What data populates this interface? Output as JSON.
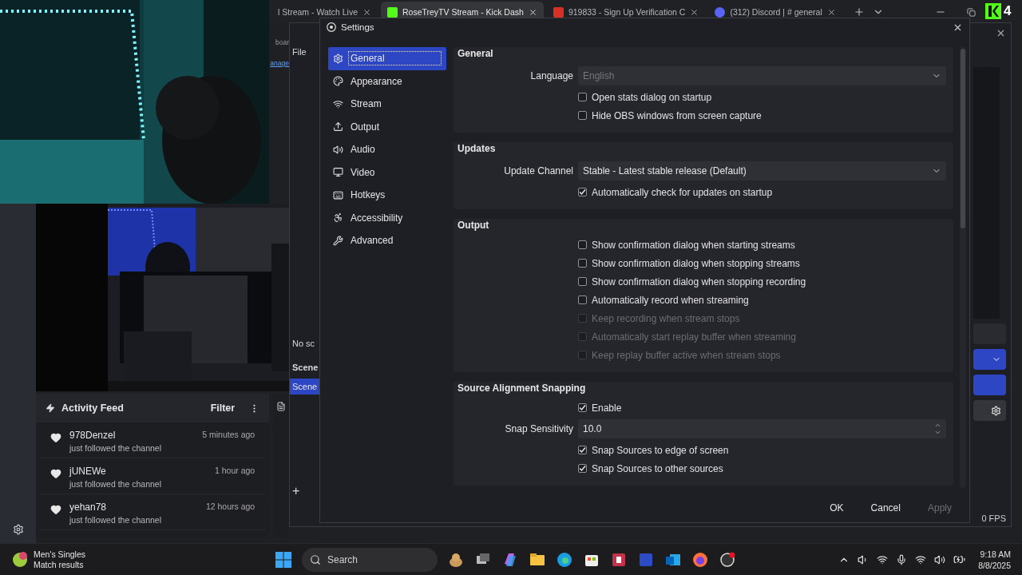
{
  "browser": {
    "tabs": [
      {
        "title": "l Stream - Watch Live",
        "selected": false
      },
      {
        "title": "RoseTreyTV Stream - Kick Dash",
        "selected": true
      },
      {
        "title": "919833 - Sign Up Verification C",
        "selected": false
      },
      {
        "title": "(312) Discord | # general",
        "selected": false
      }
    ],
    "page_fragments": [
      "boar",
      "anage"
    ]
  },
  "stream_overlay": {
    "follower_count": "4"
  },
  "activity_feed": {
    "title": "Activity Feed",
    "filter": "Filter",
    "items": [
      {
        "name": "978Denzel",
        "time": "5 minutes ago",
        "action": "just followed the channel"
      },
      {
        "name": "jUNEWe",
        "time": "1 hour ago",
        "action": "just followed the channel"
      },
      {
        "name": "yehan78",
        "time": "12 hours ago",
        "action": "just followed the channel"
      }
    ]
  },
  "obs_window": {
    "menu_item": "File",
    "sources_text": "No sc",
    "scenes_header": "Scene",
    "scenes": [
      {
        "name": "Scene",
        "selected": true
      }
    ],
    "add_button": "+",
    "fps": "0 FPS"
  },
  "settings": {
    "title": "Settings",
    "sidebar": [
      {
        "label": "General",
        "selected": true
      },
      {
        "label": "Appearance",
        "selected": false
      },
      {
        "label": "Stream",
        "selected": false
      },
      {
        "label": "Output",
        "selected": false
      },
      {
        "label": "Audio",
        "selected": false
      },
      {
        "label": "Video",
        "selected": false
      },
      {
        "label": "Hotkeys",
        "selected": false
      },
      {
        "label": "Accessibility",
        "selected": false
      },
      {
        "label": "Advanced",
        "selected": false
      }
    ],
    "sections": [
      {
        "title": "General",
        "rows": [
          {
            "kind": "dropdown",
            "label": "Language",
            "value": "English",
            "disabled": true
          },
          {
            "kind": "checkbox",
            "label": "Open stats dialog on startup",
            "checked": false,
            "disabled": false
          },
          {
            "kind": "checkbox",
            "label": "Hide OBS windows from screen capture",
            "checked": false,
            "disabled": false
          }
        ]
      },
      {
        "title": "Updates",
        "rows": [
          {
            "kind": "dropdown",
            "label": "Update Channel",
            "value": "Stable - Latest stable release (Default)",
            "disabled": false
          },
          {
            "kind": "checkbox",
            "label": "Automatically check for updates on startup",
            "checked": true,
            "disabled": false
          }
        ]
      },
      {
        "title": "Output",
        "rows": [
          {
            "kind": "checkbox",
            "label": "Show confirmation dialog when starting streams",
            "checked": false,
            "disabled": false
          },
          {
            "kind": "checkbox",
            "label": "Show confirmation dialog when stopping streams",
            "checked": false,
            "disabled": false
          },
          {
            "kind": "checkbox",
            "label": "Show confirmation dialog when stopping recording",
            "checked": false,
            "disabled": false
          },
          {
            "kind": "checkbox",
            "label": "Automatically record when streaming",
            "checked": false,
            "disabled": false
          },
          {
            "kind": "checkbox",
            "label": "Keep recording when stream stops",
            "checked": false,
            "disabled": true
          },
          {
            "kind": "checkbox",
            "label": "Automatically start replay buffer when streaming",
            "checked": false,
            "disabled": true
          },
          {
            "kind": "checkbox",
            "label": "Keep replay buffer active when stream stops",
            "checked": false,
            "disabled": true
          }
        ]
      },
      {
        "title": "Source Alignment Snapping",
        "rows": [
          {
            "kind": "checkbox",
            "label": "Enable",
            "checked": true,
            "disabled": false
          },
          {
            "kind": "spin",
            "label": "Snap Sensitivity",
            "value": "10.0"
          },
          {
            "kind": "checkbox",
            "label": "Snap Sources to edge of screen",
            "checked": true,
            "disabled": false
          },
          {
            "kind": "checkbox",
            "label": "Snap Sources to other sources",
            "checked": true,
            "disabled": false
          }
        ]
      }
    ],
    "buttons": [
      {
        "label": "OK",
        "disabled": false
      },
      {
        "label": "Cancel",
        "disabled": false
      },
      {
        "label": "Apply",
        "disabled": true
      }
    ]
  },
  "taskbar": {
    "widget": {
      "title": "Men's Singles",
      "subtitle": "Match results"
    },
    "search": {
      "placeholder": "Search"
    },
    "time": "9:18 AM",
    "date": "8/8/2025"
  }
}
